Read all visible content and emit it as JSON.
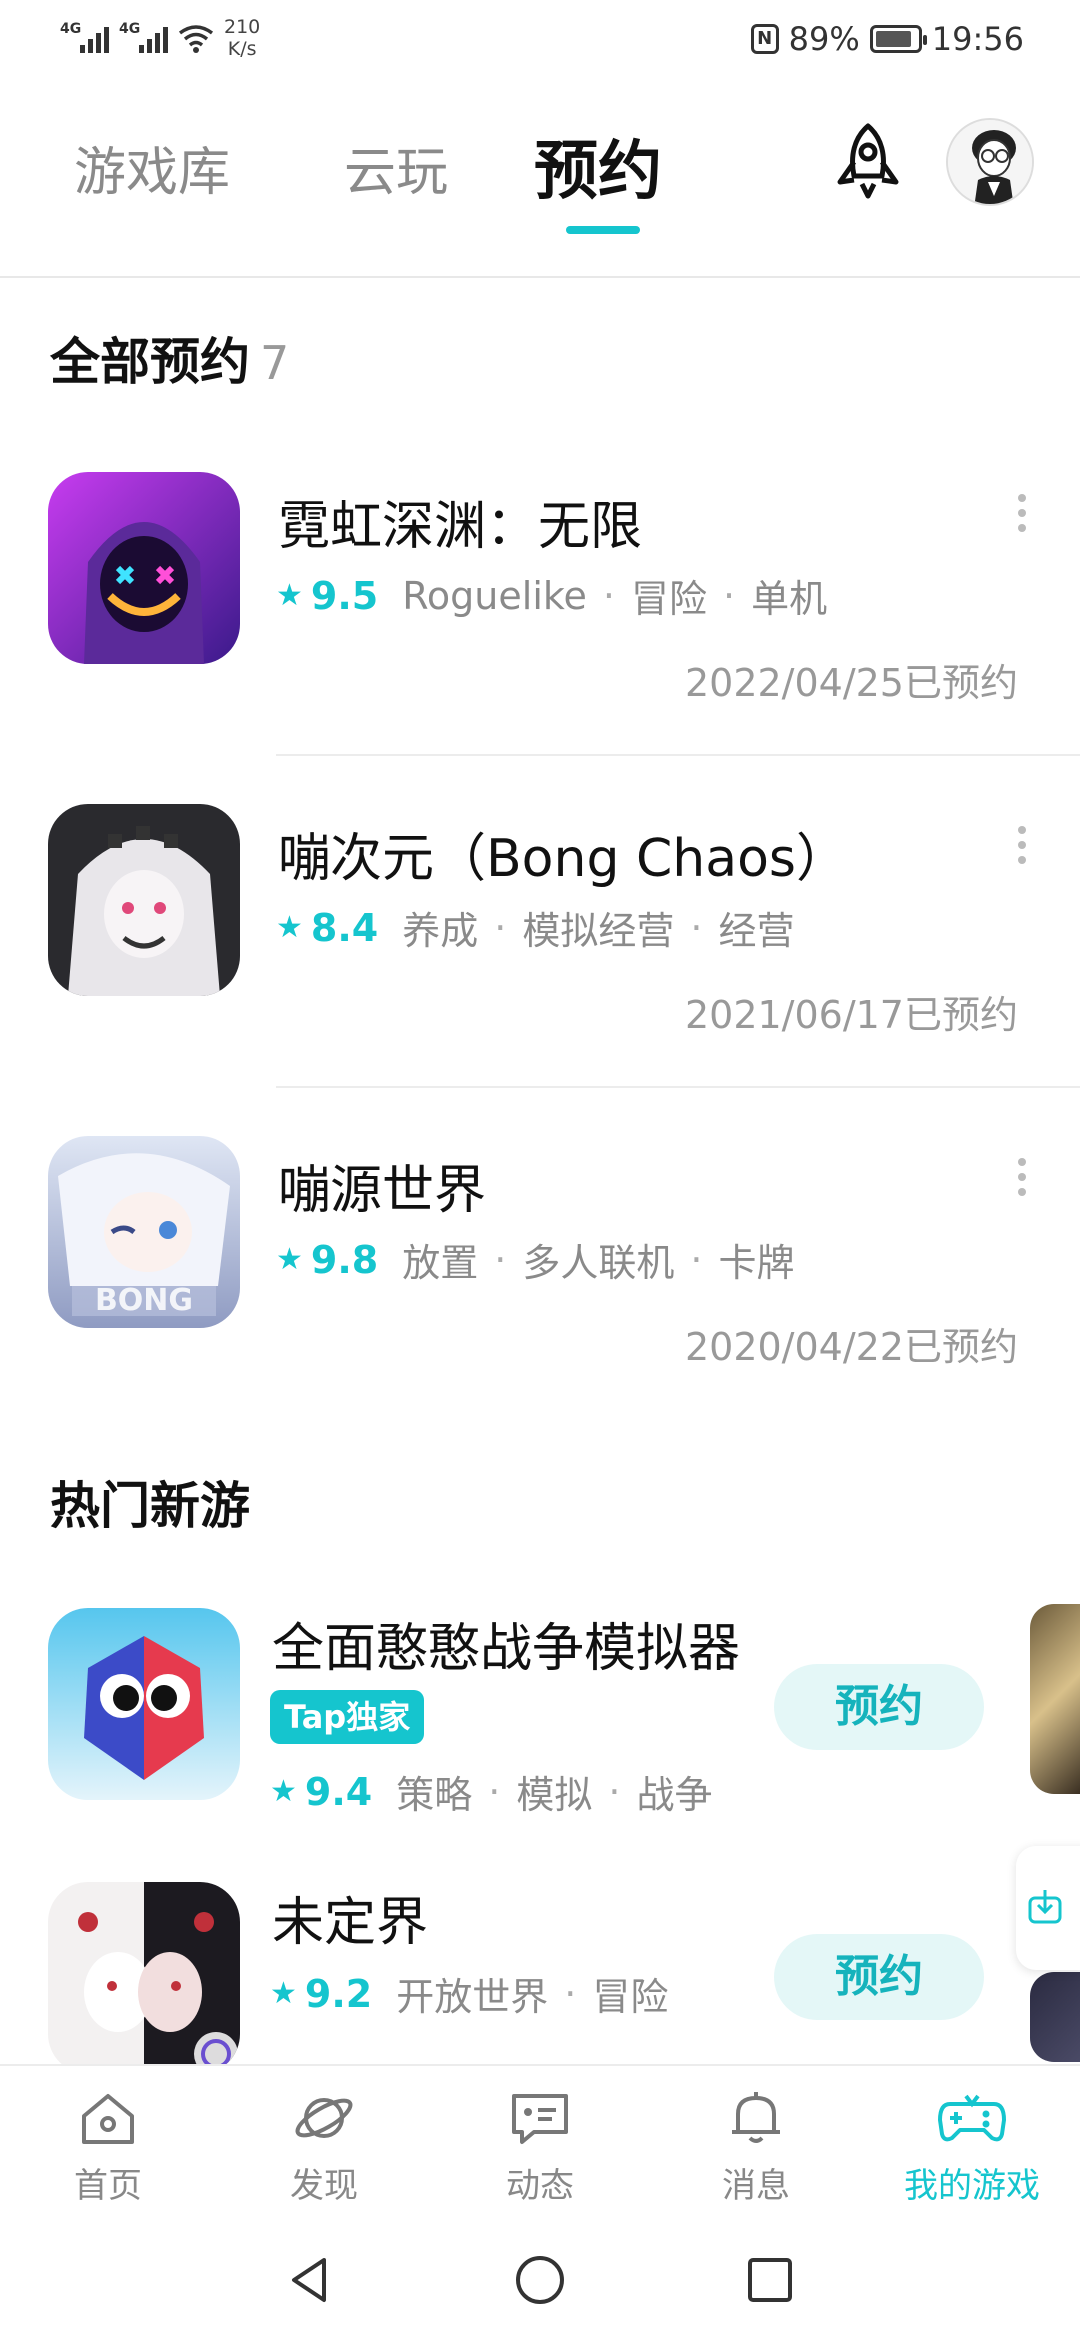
{
  "status_bar": {
    "net1": "4G",
    "net2": "4G",
    "speed_value": "210",
    "speed_unit": "K/s",
    "nfc": "N",
    "battery": "89%",
    "battery_level": 0.89,
    "time": "19:56"
  },
  "top_tabs": {
    "tab_library": "游戏库",
    "tab_cloud": "云玩",
    "tab_reserve": "预约",
    "active": "预约"
  },
  "all_reservations": {
    "title": "全部预约",
    "count": "7",
    "items": [
      {
        "name": "霓虹深渊：无限",
        "rating": "9.5",
        "tags": [
          "Roguelike",
          "冒险",
          "单机"
        ],
        "date": "2022/04/25已预约"
      },
      {
        "name": "嘣次元（Bong Chaos）",
        "rating": "8.4",
        "tags": [
          "养成",
          "模拟经营",
          "经营"
        ],
        "date": "2021/06/17已预约"
      },
      {
        "name": "嘣源世界",
        "rating": "9.8",
        "tags": [
          "放置",
          "多人联机",
          "卡牌"
        ],
        "date": "2020/04/22已预约"
      }
    ]
  },
  "hot_new": {
    "title": "热门新游",
    "items": [
      {
        "name": "全面憨憨战争模拟器",
        "badge": "Tap独家",
        "rating": "9.4",
        "tags": [
          "策略",
          "模拟",
          "战争"
        ],
        "button": "预约"
      },
      {
        "name": "未定界",
        "rating": "9.2",
        "tags": [
          "开放世界",
          "冒险"
        ],
        "button": "预约"
      }
    ]
  },
  "bottom_nav": {
    "home": "首页",
    "discover": "发现",
    "feed": "动态",
    "messages": "消息",
    "my_games": "我的游戏",
    "active": "我的游戏"
  },
  "colors": {
    "accent": "#15c5ce",
    "accent_light": "#e4f7f7",
    "text_primary": "#111111",
    "text_secondary": "#8a8a8a"
  },
  "icons": {
    "top_right": "rocket-icon",
    "nav": [
      "home-icon",
      "planet-icon",
      "chat-icon",
      "bell-icon",
      "gamepad-icon"
    ],
    "system": [
      "back-icon",
      "home-circle-icon",
      "recents-icon"
    ]
  }
}
